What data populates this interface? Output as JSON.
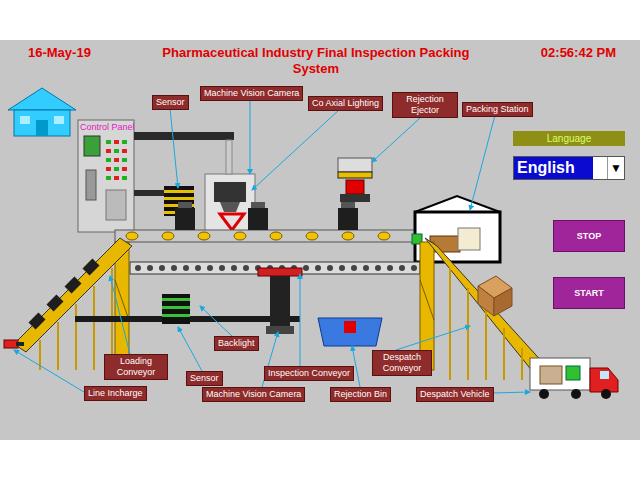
{
  "header": {
    "date": "16-May-19",
    "title_lines": [
      "Pharmaceutical Industry Final Inspection Packing",
      "System"
    ],
    "time": "02:56:42 PM"
  },
  "control_panel": {
    "label": "Control Panel"
  },
  "tags": {
    "sensor_top": "Sensor",
    "camera_top": "Machine Vision Camera",
    "coaxial": "Co Axial Lighting",
    "ejector": "Rejection Ejector",
    "packing": "Packing Station",
    "loading": "Loading Conveyor",
    "backlight": "Backlight",
    "sensor_bottom": "Sensor",
    "inspection": "Inspection Conveyor",
    "despatch_conveyor": "Despatch Conveyor",
    "line_incharge": "Line Incharge",
    "camera_bottom": "Machine Vision Camera",
    "rejection_bin": "Rejection Bin",
    "despatch_vehicle": "Despatch Vehicle"
  },
  "language": {
    "label": "Language",
    "value": "English",
    "arrow": "▼"
  },
  "buttons": [
    {
      "label": "STOP"
    },
    {
      "label": "START"
    }
  ]
}
